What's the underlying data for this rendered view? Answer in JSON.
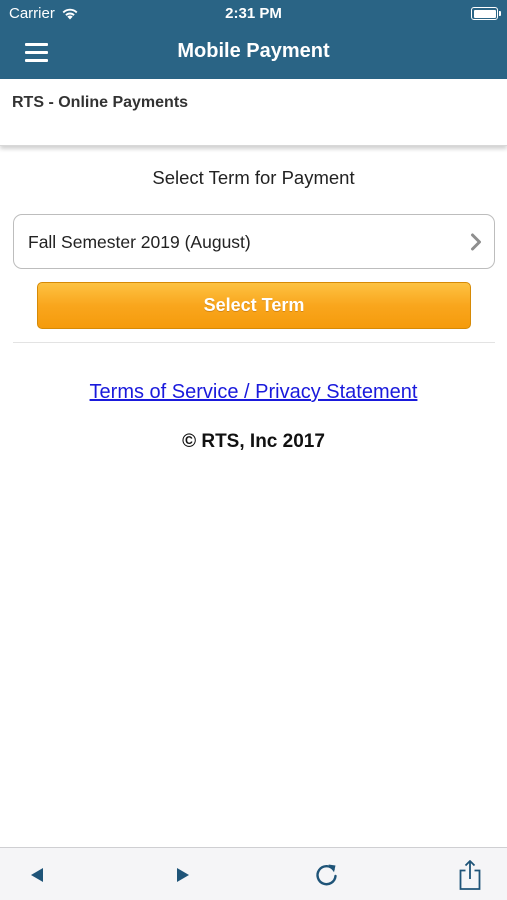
{
  "status_bar": {
    "carrier": "Carrier",
    "time": "2:31 PM"
  },
  "nav": {
    "title": "Mobile Payment",
    "menu_icon": "hamburger-icon"
  },
  "subheader": {
    "label": "RTS - Online Payments"
  },
  "main": {
    "heading": "Select Term for Payment",
    "term_select": {
      "value": "Fall Semester 2019 (August)",
      "icon": "chevron-right-icon"
    },
    "select_button_label": "Select Term",
    "terms_link": "Terms of Service / Privacy Statement",
    "copyright": "© RTS, Inc 2017"
  },
  "toolbar": {
    "icons": [
      "back-arrow-icon",
      "forward-arrow-icon",
      "reload-icon",
      "share-icon"
    ]
  },
  "colors": {
    "header": "#2a6485",
    "button": "#f9a61d",
    "link": "#1a1adc",
    "toolbar_icon": "#1f5478"
  }
}
